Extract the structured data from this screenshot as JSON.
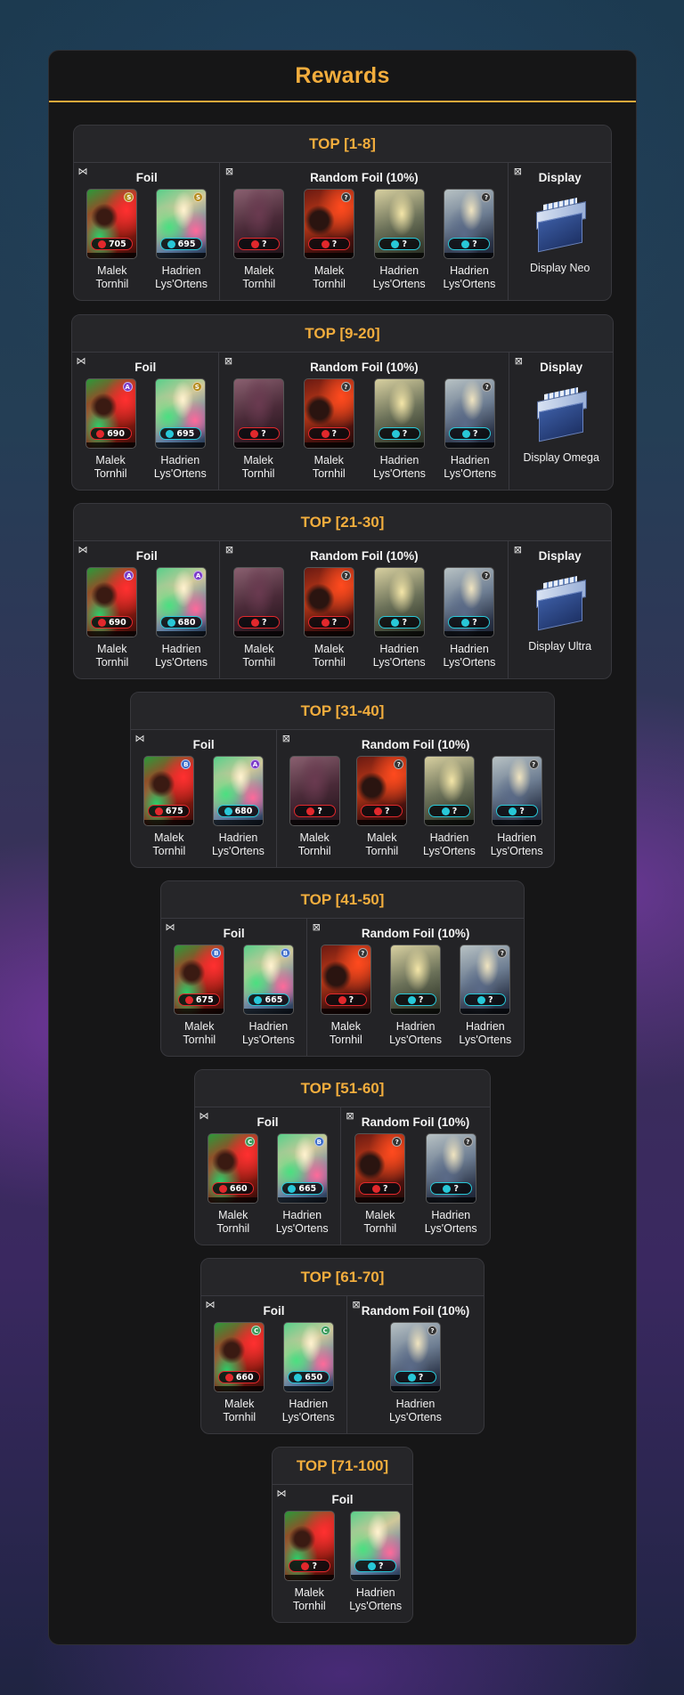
{
  "title": "Rewards",
  "colors": {
    "accent": "#f2ad3d",
    "panel": "#161617",
    "tier": "#232326",
    "malek_stat": "#e2282c",
    "hadrien_stat": "#28c8d8"
  },
  "icons": {
    "foil_section": "bowtie-icon",
    "random_section": "crossed-square-icon",
    "display_section": "crossed-square-icon"
  },
  "tiers": [
    {
      "title": "TOP [1-8]",
      "foil": {
        "title": "Foil",
        "cards": [
          {
            "name1": "Malek",
            "name2": "Tornhil",
            "stat": "705",
            "rarity": "S"
          },
          {
            "name1": "Hadrien",
            "name2": "Lys'Ortens",
            "stat": "695",
            "rarity": "S"
          }
        ]
      },
      "random": {
        "title": "Random Foil  (10%)",
        "cards": [
          {
            "name1": "Malek",
            "name2": "Tornhil",
            "stat": "?",
            "rarity": ""
          },
          {
            "name1": "Malek",
            "name2": "Tornhil",
            "stat": "?",
            "rarity": "?"
          },
          {
            "name1": "Hadrien",
            "name2": "Lys'Ortens",
            "stat": "?",
            "rarity": ""
          },
          {
            "name1": "Hadrien",
            "name2": "Lys'Ortens",
            "stat": "?",
            "rarity": "?"
          }
        ]
      },
      "display": {
        "title": "Display",
        "label": "Display Neo"
      }
    },
    {
      "title": "TOP [9-20]",
      "foil": {
        "title": "Foil",
        "cards": [
          {
            "name1": "Malek",
            "name2": "Tornhil",
            "stat": "690",
            "rarity": "A"
          },
          {
            "name1": "Hadrien",
            "name2": "Lys'Ortens",
            "stat": "695",
            "rarity": "S"
          }
        ]
      },
      "random": {
        "title": "Random Foil (10%)",
        "cards": [
          {
            "name1": "Malek",
            "name2": "Tornhil",
            "stat": "?",
            "rarity": ""
          },
          {
            "name1": "Malek",
            "name2": "Tornhil",
            "stat": "?",
            "rarity": "?"
          },
          {
            "name1": "Hadrien",
            "name2": "Lys'Ortens",
            "stat": "?",
            "rarity": ""
          },
          {
            "name1": "Hadrien",
            "name2": "Lys'Ortens",
            "stat": "?",
            "rarity": "?"
          }
        ]
      },
      "display": {
        "title": "Display",
        "label": "Display Omega"
      }
    },
    {
      "title": "TOP [21-30]",
      "foil": {
        "title": "Foil",
        "cards": [
          {
            "name1": "Malek",
            "name2": "Tornhil",
            "stat": "690",
            "rarity": "A"
          },
          {
            "name1": "Hadrien",
            "name2": "Lys'Ortens",
            "stat": "680",
            "rarity": "A"
          }
        ]
      },
      "random": {
        "title": "Random Foil (10%)",
        "cards": [
          {
            "name1": "Malek",
            "name2": "Tornhil",
            "stat": "?",
            "rarity": ""
          },
          {
            "name1": "Malek",
            "name2": "Tornhil",
            "stat": "?",
            "rarity": "?"
          },
          {
            "name1": "Hadrien",
            "name2": "Lys'Ortens",
            "stat": "?",
            "rarity": ""
          },
          {
            "name1": "Hadrien",
            "name2": "Lys'Ortens",
            "stat": "?",
            "rarity": "?"
          }
        ]
      },
      "display": {
        "title": "Display",
        "label": "Display Ultra"
      }
    },
    {
      "title": "TOP [31-40]",
      "foil": {
        "title": "Foil",
        "cards": [
          {
            "name1": "Malek",
            "name2": "Tornhil",
            "stat": "675",
            "rarity": "B"
          },
          {
            "name1": "Hadrien",
            "name2": "Lys'Ortens",
            "stat": "680",
            "rarity": "A"
          }
        ]
      },
      "random": {
        "title": "Random Foil (10%)",
        "cards": [
          {
            "name1": "Malek",
            "name2": "Tornhil",
            "stat": "?",
            "rarity": ""
          },
          {
            "name1": "Malek",
            "name2": "Tornhil",
            "stat": "?",
            "rarity": "?"
          },
          {
            "name1": "Hadrien",
            "name2": "Lys'Ortens",
            "stat": "?",
            "rarity": ""
          },
          {
            "name1": "Hadrien",
            "name2": "Lys'Ortens",
            "stat": "?",
            "rarity": "?"
          }
        ]
      }
    },
    {
      "title": "TOP [41-50]",
      "foil": {
        "title": "Foil",
        "cards": [
          {
            "name1": "Malek",
            "name2": "Tornhil",
            "stat": "675",
            "rarity": "B"
          },
          {
            "name1": "Hadrien",
            "name2": "Lys'Ortens",
            "stat": "665",
            "rarity": "B"
          }
        ]
      },
      "random": {
        "title": "Random Foil (10%)",
        "cards": [
          {
            "name1": "Malek",
            "name2": "Tornhil",
            "stat": "?",
            "rarity": "?"
          },
          {
            "name1": "Hadrien",
            "name2": "Lys'Ortens",
            "stat": "?",
            "rarity": ""
          },
          {
            "name1": "Hadrien",
            "name2": "Lys'Ortens",
            "stat": "?",
            "rarity": "?"
          }
        ]
      }
    },
    {
      "title": "TOP [51-60]",
      "foil": {
        "title": "Foil",
        "cards": [
          {
            "name1": "Malek",
            "name2": "Tornhil",
            "stat": "660",
            "rarity": "C"
          },
          {
            "name1": "Hadrien",
            "name2": "Lys'Ortens",
            "stat": "665",
            "rarity": "B"
          }
        ]
      },
      "random": {
        "title": "Random Foil (10%)",
        "cards": [
          {
            "name1": "Malek",
            "name2": "Tornhil",
            "stat": "?",
            "rarity": "?"
          },
          {
            "name1": "Hadrien",
            "name2": "Lys'Ortens",
            "stat": "?",
            "rarity": "?"
          }
        ]
      }
    },
    {
      "title": "TOP [61-70]",
      "foil": {
        "title": "Foil",
        "cards": [
          {
            "name1": "Malek",
            "name2": "Tornhil",
            "stat": "660",
            "rarity": "C"
          },
          {
            "name1": "Hadrien",
            "name2": "Lys'Ortens",
            "stat": "650",
            "rarity": "C"
          }
        ]
      },
      "random": {
        "title": "Random Foil (10%)",
        "cards": [
          {
            "name1": "Hadrien",
            "name2": "Lys'Ortens",
            "stat": "?",
            "rarity": "?"
          }
        ]
      }
    },
    {
      "title": "TOP [71-100]",
      "foil": {
        "title": "Foil",
        "cards": [
          {
            "name1": "Malek",
            "name2": "Tornhil",
            "stat": "?",
            "rarity": ""
          },
          {
            "name1": "Hadrien",
            "name2": "Lys'Ortens",
            "stat": "?",
            "rarity": ""
          }
        ]
      }
    }
  ]
}
